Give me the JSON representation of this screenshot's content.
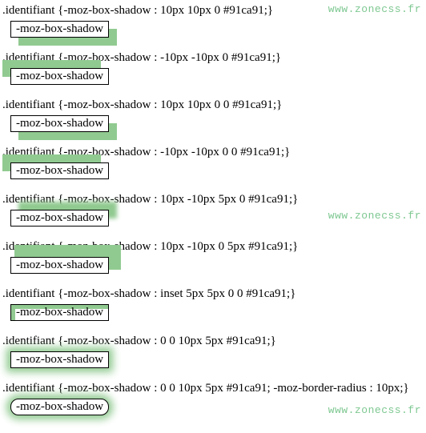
{
  "watermark": "www.zonecss.fr",
  "box_label": "-moz-box-shadow",
  "shadow_color": "#91ca91",
  "examples": [
    {
      "code": ".identifiant {-moz-box-shadow : 10px 10px 0 #91ca91;}",
      "shadow": "10px 10px 0 #91ca91",
      "radius": "0"
    },
    {
      "code": ".identifiant {-moz-box-shadow : -10px -10px 0 #91ca91;}",
      "shadow": "-10px -10px 0 #91ca91",
      "radius": "0"
    },
    {
      "code": ".identifiant {-moz-box-shadow : 10px 10px 0 0 #91ca91;}",
      "shadow": "10px 10px 0 0 #91ca91",
      "radius": "0"
    },
    {
      "code": ".identifiant {-moz-box-shadow : -10px -10px 0 0 #91ca91;}",
      "shadow": "-10px -10px 0 0 #91ca91",
      "radius": "0"
    },
    {
      "code": ".identifiant {-moz-box-shadow : 10px -10px 5px 0 #91ca91;}",
      "shadow": "10px -10px 5px 0 #91ca91",
      "radius": "0"
    },
    {
      "code": ".identifiant {-moz-box-shadow : 10px -10px 0 5px #91ca91;}",
      "shadow": "10px -10px 0 5px #91ca91",
      "radius": "0"
    },
    {
      "code": ".identifiant {-moz-box-shadow : inset 5px 5px 0 0 #91ca91;}",
      "shadow": "inset 5px 5px 0 0 #91ca91",
      "radius": "0"
    },
    {
      "code": ".identifiant {-moz-box-shadow : 0 0 10px 5px #91ca91;}",
      "shadow": "0 0 10px 5px #91ca91",
      "radius": "0"
    },
    {
      "code": ".identifiant {-moz-box-shadow : 0 0 10px 5px #91ca91; -moz-border-radius : 10px;}",
      "shadow": "0 0 10px 5px #91ca91",
      "radius": "10px"
    }
  ]
}
